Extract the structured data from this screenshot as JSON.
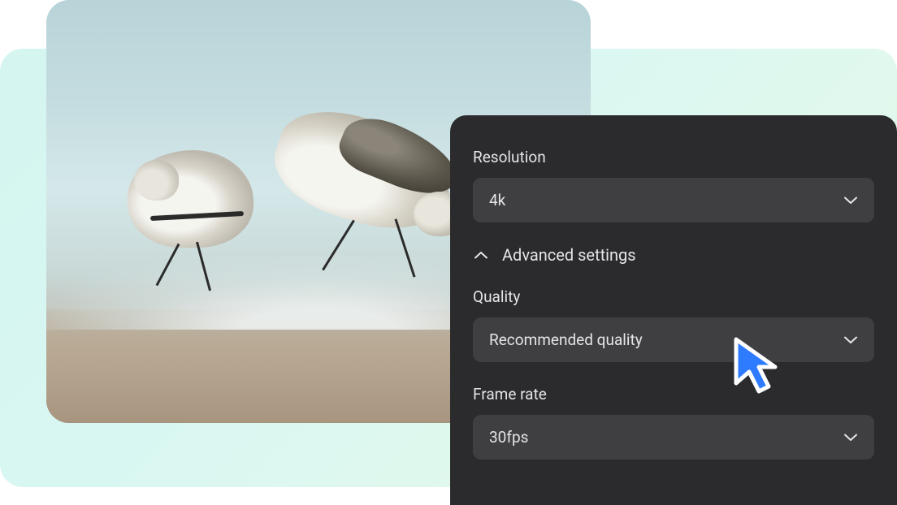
{
  "settings": {
    "resolution": {
      "label": "Resolution",
      "value": "4k"
    },
    "advanced": {
      "label": "Advanced settings"
    },
    "quality": {
      "label": "Quality",
      "value": "Recommended quality"
    },
    "framerate": {
      "label": "Frame rate",
      "value": "30fps"
    }
  }
}
